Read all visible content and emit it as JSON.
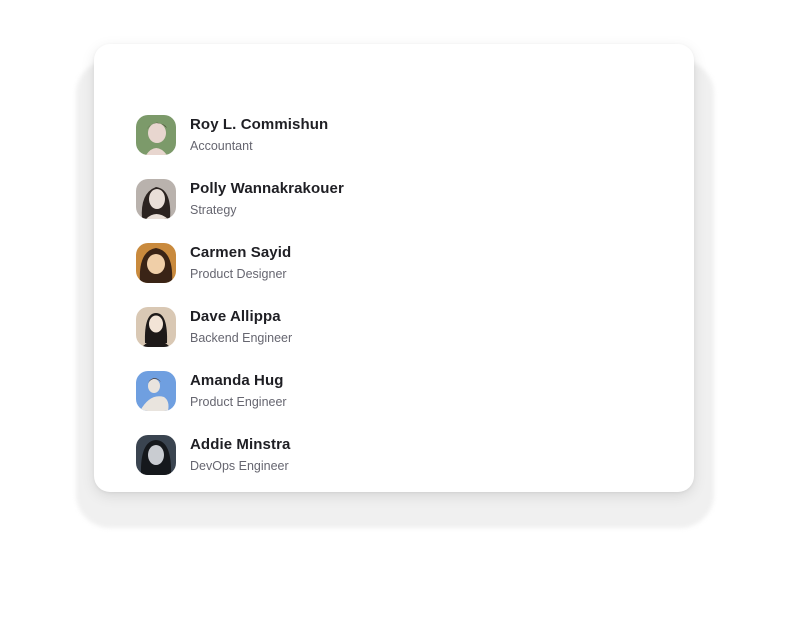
{
  "people": [
    {
      "name": "Roy L. Commishun",
      "role": "Accountant",
      "avatar_colors": [
        "#7c9a6a",
        "#e8d6cf",
        "#3b2a24"
      ]
    },
    {
      "name": "Polly Wannakrakouer",
      "role": "Strategy",
      "avatar_colors": [
        "#b9b2ad",
        "#e9dfd8",
        "#2b2320"
      ]
    },
    {
      "name": "Carmen Sayid",
      "role": "Product Designer",
      "avatar_colors": [
        "#c98a3d",
        "#f0cfa8",
        "#3a2416"
      ]
    },
    {
      "name": "Dave Allippa",
      "role": "Backend Engineer",
      "avatar_colors": [
        "#d9c8b4",
        "#f2e4d6",
        "#1e1a19"
      ]
    },
    {
      "name": "Amanda Hug",
      "role": "Product Engineer",
      "avatar_colors": [
        "#6f9fe0",
        "#e9e4de",
        "#4b3a30"
      ]
    },
    {
      "name": "Addie Minstra",
      "role": "DevOps Engineer",
      "avatar_colors": [
        "#3a4450",
        "#c9ccd1",
        "#15181c"
      ]
    }
  ]
}
